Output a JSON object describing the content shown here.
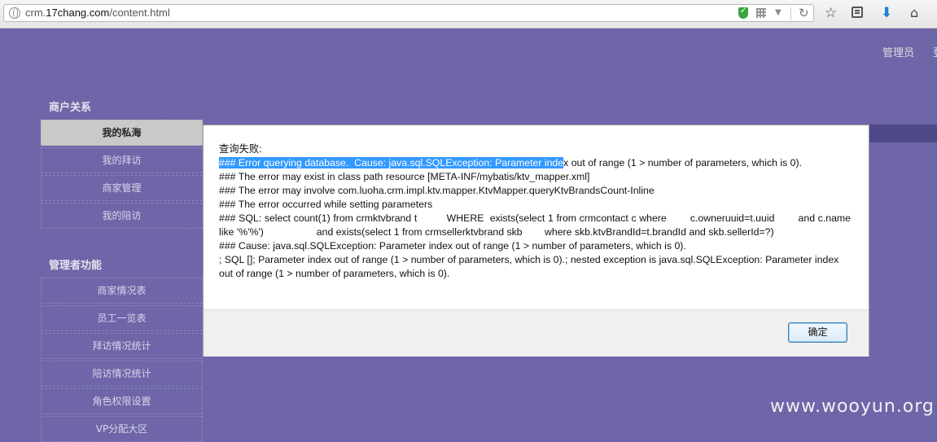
{
  "browser": {
    "url_prefix": "crm.",
    "url_domain": "17chang.com",
    "url_path": "/content.html"
  },
  "header": {
    "user_label": "管理员",
    "extra_label": "登"
  },
  "sidebar": {
    "section1_title": "商户关系",
    "section1_items": [
      "我的私海",
      "我的拜访",
      "商家管理",
      "我的陪访"
    ],
    "section2_title": "管理者功能",
    "section2_items": [
      "商家情况表",
      "员工一览表",
      "拜访情况统计",
      "陪访情况统计",
      "角色权限设置",
      "VP分配大区"
    ]
  },
  "dialog": {
    "heading": "查询失败:",
    "line1_selected": "### Error querying database.  Cause: java.sql.SQLException: Parameter inde",
    "line1_rest": "x out of range (1 > number of parameters, which is 0).",
    "line2": "### The error may exist in class path resource [META-INF/mybatis/ktv_mapper.xml]",
    "line3": "### The error may involve com.luoha.crm.impl.ktv.mapper.KtvMapper.queryKtvBrandsCount-Inline",
    "line4": "### The error occurred while setting parameters",
    "sql": "### SQL: select count(1) from crmktvbrand t          WHERE  exists(select 1 from crmcontact c where        c.owneruuid=t.uuid        and c.name like '%'%')                   and exists(select 1 from crmsellerktvbrand skb        where skb.ktvBrandId=t.brandId and skb.sellerId=?)",
    "cause": "### Cause: java.sql.SQLException: Parameter index out of range (1 > number of parameters, which is 0).",
    "nested": "; SQL []; Parameter index out of range (1 > number of parameters, which is 0).; nested exception is java.sql.SQLException: Parameter index out of range (1 > number of parameters, which is 0).",
    "ok_label": "确定"
  },
  "watermark": "www.wooyun.org"
}
